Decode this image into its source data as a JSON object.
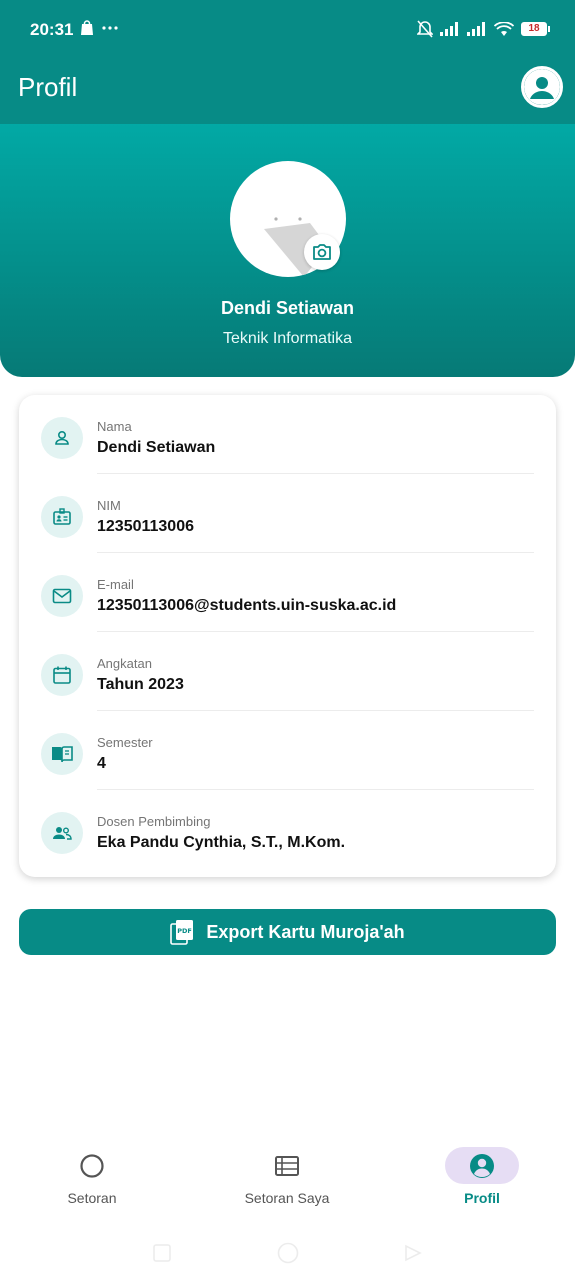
{
  "status_bar": {
    "time": "20:31",
    "battery": "18"
  },
  "app_bar": {
    "title": "Profil"
  },
  "profile": {
    "name": "Dendi Setiawan",
    "major": "Teknik Informatika"
  },
  "info": [
    {
      "label": "Nama",
      "value": "Dendi Setiawan",
      "icon": "person-icon"
    },
    {
      "label": "NIM",
      "value": "12350113006",
      "icon": "id-badge-icon"
    },
    {
      "label": "E-mail",
      "value": "12350113006@students.uin-suska.ac.id",
      "icon": "mail-icon"
    },
    {
      "label": "Angkatan",
      "value": "Tahun 2023",
      "icon": "calendar-icon"
    },
    {
      "label": "Semester",
      "value": "4",
      "icon": "book-icon"
    },
    {
      "label": "Dosen Pembimbing",
      "value": "Eka Pandu Cynthia, S.T., M.Kom.",
      "icon": "supervisor-icon"
    }
  ],
  "export_button": {
    "label": "Export Kartu Muroja'ah",
    "icon": "pdf-icon"
  },
  "bottom_nav": [
    {
      "label": "Setoran",
      "icon": "circle-icon",
      "active": false
    },
    {
      "label": "Setoran Saya",
      "icon": "list-icon",
      "active": false
    },
    {
      "label": "Profil",
      "icon": "account-circle-icon",
      "active": true
    }
  ],
  "colors": {
    "primary": "#078B86",
    "hero_top": "#02A9A5",
    "hero_bottom": "#067A76",
    "icon_bg": "#E2F3F2",
    "nav_active_bg": "#E6DDF4"
  }
}
